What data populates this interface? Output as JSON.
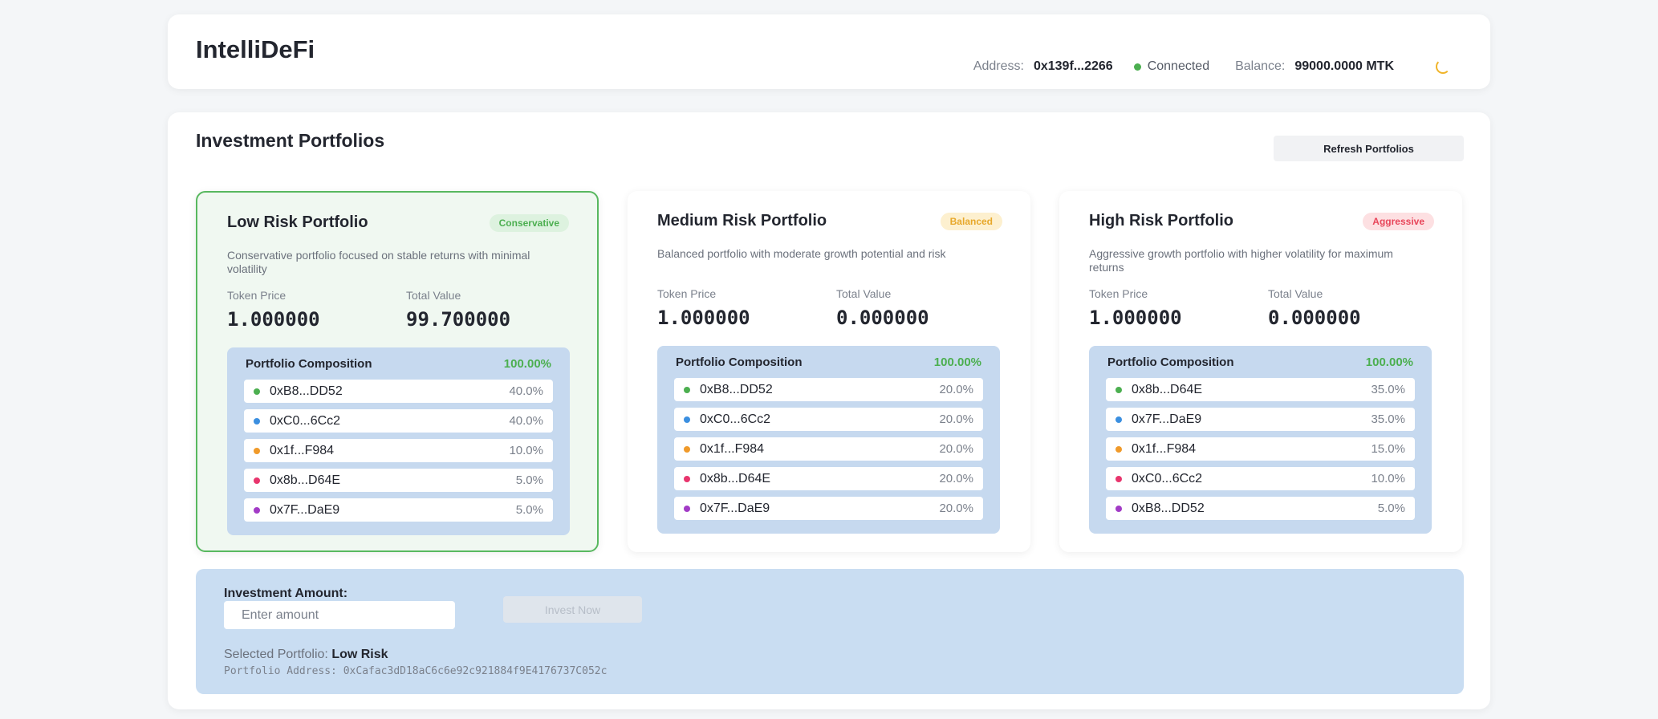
{
  "app": {
    "name": "IntelliDeFi"
  },
  "wallet": {
    "address_label": "Address:",
    "address": "0x139f...2266",
    "status": "Connected",
    "status_color": "#4caf50",
    "balance_label": "Balance:",
    "balance": "99000.0000 MTK"
  },
  "main": {
    "title": "Investment Portfolios",
    "refresh_label": "Refresh Portfolios"
  },
  "portfolios": [
    {
      "title": "Low Risk Portfolio",
      "badge": "Conservative",
      "badge_bg": "#ddf2df",
      "badge_color": "#4caf50",
      "description": "Conservative portfolio focused on stable returns with minimal volatility",
      "token_price_label": "Token Price",
      "token_price": "1.000000",
      "total_value_label": "Total Value",
      "total_value": "99.700000",
      "selected": true,
      "composition_title": "Portfolio Composition",
      "composition_total": "100.00%",
      "composition": [
        {
          "address": "0xB8...DD52",
          "percent": "40.0%",
          "color": "#4caf50"
        },
        {
          "address": "0xC0...6Cc2",
          "percent": "40.0%",
          "color": "#3b8fe0"
        },
        {
          "address": "0x1f...F984",
          "percent": "10.0%",
          "color": "#f09a2a"
        },
        {
          "address": "0x8b...D64E",
          "percent": "5.0%",
          "color": "#e8356d"
        },
        {
          "address": "0x7F...DaE9",
          "percent": "5.0%",
          "color": "#a23bc6"
        }
      ]
    },
    {
      "title": "Medium Risk Portfolio",
      "badge": "Balanced",
      "badge_bg": "#fdf0cf",
      "badge_color": "#e7a82b",
      "description": "Balanced portfolio with moderate growth potential and risk",
      "token_price_label": "Token Price",
      "token_price": "1.000000",
      "total_value_label": "Total Value",
      "total_value": "0.000000",
      "selected": false,
      "composition_title": "Portfolio Composition",
      "composition_total": "100.00%",
      "composition": [
        {
          "address": "0xB8...DD52",
          "percent": "20.0%",
          "color": "#4caf50"
        },
        {
          "address": "0xC0...6Cc2",
          "percent": "20.0%",
          "color": "#3b8fe0"
        },
        {
          "address": "0x1f...F984",
          "percent": "20.0%",
          "color": "#f09a2a"
        },
        {
          "address": "0x8b...D64E",
          "percent": "20.0%",
          "color": "#e8356d"
        },
        {
          "address": "0x7F...DaE9",
          "percent": "20.0%",
          "color": "#a23bc6"
        }
      ]
    },
    {
      "title": "High Risk Portfolio",
      "badge": "Aggressive",
      "badge_bg": "#fde0e2",
      "badge_color": "#e8465a",
      "description": "Aggressive growth portfolio with higher volatility for maximum returns",
      "token_price_label": "Token Price",
      "token_price": "1.000000",
      "total_value_label": "Total Value",
      "total_value": "0.000000",
      "selected": false,
      "composition_title": "Portfolio Composition",
      "composition_total": "100.00%",
      "composition": [
        {
          "address": "0x8b...D64E",
          "percent": "35.0%",
          "color": "#4caf50"
        },
        {
          "address": "0x7F...DaE9",
          "percent": "35.0%",
          "color": "#3b8fe0"
        },
        {
          "address": "0x1f...F984",
          "percent": "15.0%",
          "color": "#f09a2a"
        },
        {
          "address": "0xC0...6Cc2",
          "percent": "10.0%",
          "color": "#e8356d"
        },
        {
          "address": "0xB8...DD52",
          "percent": "5.0%",
          "color": "#a23bc6"
        }
      ]
    }
  ],
  "invest": {
    "amount_label": "Investment Amount:",
    "amount_placeholder": "Enter amount",
    "button_label": "Invest Now",
    "selected_label": "Selected Portfolio:",
    "selected_value": "Low Risk",
    "address_label": "Portfolio Address:",
    "address_value": "0xCafac3dD18aC6c6e92c921884f9E4176737C052c"
  }
}
